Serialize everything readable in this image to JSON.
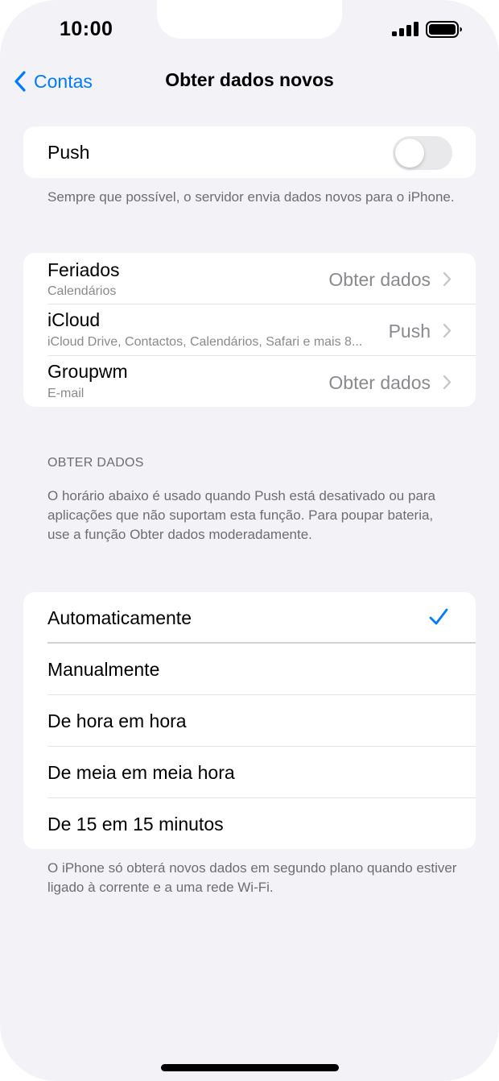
{
  "status_bar": {
    "time": "10:00"
  },
  "nav": {
    "back_label": "Contas",
    "title": "Obter dados novos"
  },
  "push": {
    "label": "Push",
    "enabled": false,
    "footer": "Sempre que possível, o servidor envia dados novos para o iPhone."
  },
  "accounts": [
    {
      "name": "Feriados",
      "subtitle": "Calendários",
      "value": "Obter dados"
    },
    {
      "name": "iCloud",
      "subtitle": "iCloud Drive, Contactos, Calendários, Safari e mais 8...",
      "value": "Push"
    },
    {
      "name": "Groupwm",
      "subtitle": "E-mail",
      "value": "Obter dados"
    }
  ],
  "fetch": {
    "header": "OBTER DADOS",
    "description": "O horário abaixo é usado quando Push está desativado ou para aplicações que não suportam esta função. Para poupar bateria, use a função Obter dados moderadamente.",
    "options": [
      {
        "label": "Automaticamente",
        "selected": true
      },
      {
        "label": "Manualmente",
        "selected": false
      },
      {
        "label": "De hora em hora",
        "selected": false
      },
      {
        "label": "De meia em meia hora",
        "selected": false
      },
      {
        "label": "De 15 em 15 minutos",
        "selected": false
      }
    ],
    "footer": "O iPhone só obterá novos dados em segundo plano quando estiver ligado à corrente e a uma rede Wi-Fi."
  },
  "colors": {
    "accent": "#007aff",
    "background": "#f2f2f7",
    "secondary_text": "#8a8a8e"
  }
}
